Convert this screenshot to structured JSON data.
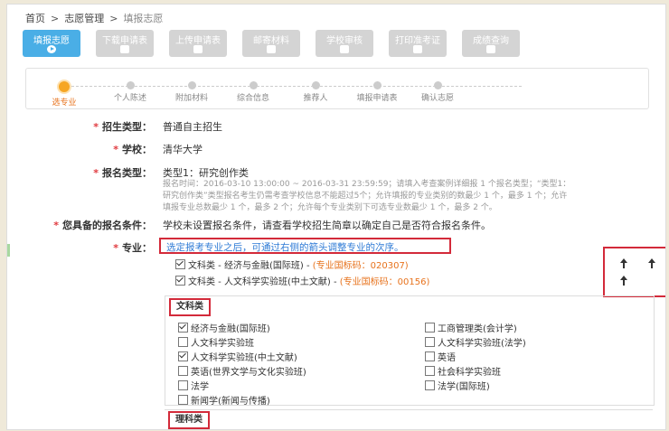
{
  "breadcrumb": [
    "首页",
    "志愿管理",
    "填报志愿"
  ],
  "tabs": [
    {
      "label": "填报志愿",
      "active": true
    },
    {
      "label": "下载申请表",
      "active": false
    },
    {
      "label": "上传申请表",
      "active": false
    },
    {
      "label": "邮寄材料",
      "active": false
    },
    {
      "label": "学校审核",
      "active": false
    },
    {
      "label": "打印准考证",
      "active": false
    },
    {
      "label": "成绩查询",
      "active": false
    }
  ],
  "steps": [
    {
      "label": "选专业",
      "active": true
    },
    {
      "label": "个人陈述",
      "active": false
    },
    {
      "label": "附加材料",
      "active": false
    },
    {
      "label": "综合信息",
      "active": false
    },
    {
      "label": "推荐人",
      "active": false
    },
    {
      "label": "填报申请表",
      "active": false
    },
    {
      "label": "确认志愿",
      "active": false
    }
  ],
  "form": {
    "recruit_type_label": "招生类型：",
    "recruit_type_value": "普通自主招生",
    "school_label": "学校：",
    "school_value": "清华大学",
    "apply_type_label": "报名类型：",
    "apply_type_value": "类型1：研究创作类",
    "note_line1": "报名时间：2016-03-10 13:00:00 ~ 2016-03-31 23:59:59；请填入考查案例详细报 1 个报名类型；“类型1：",
    "note_line2": "研究创作类”类型报名考生仍需考查学校信息不能超过5个；允许填报的专业类别的数最少 1 个，最多 1 个；允许",
    "note_line3": "填报专业总数最少 1 个，最多 2 个；允许每个专业类别下可选专业数最少 1 个，最多 2 个。",
    "condition_label": "您具备的报名条件：",
    "condition_value": "学校未设置报名条件，请查看学校招生简章以确定自己是否符合报名条件。",
    "major_label": "专业：",
    "major_tip": "选定报考专业之后，可通过右侧的箭头调整专业的次序。"
  },
  "selected_majors": [
    {
      "name": "文科类 - 经济与金融(国际班) - ",
      "code": "(专业国标码：020307)",
      "checked": true
    },
    {
      "name": "文科类 - 人文科学实验班(中土文献) - ",
      "code": "(专业国标码：00156)",
      "checked": true
    }
  ],
  "categories": [
    {
      "title": "文科类",
      "options": [
        {
          "label": "经济与金融(国际班)",
          "checked": true
        },
        {
          "label": "工商管理类(会计学)",
          "checked": false
        },
        {
          "label": "人文科学实验班",
          "checked": false
        },
        {
          "label": "人文科学实验班(法学)",
          "checked": false
        },
        {
          "label": "人文科学实验班(中土文献)",
          "checked": true
        },
        {
          "label": "英语",
          "checked": false
        },
        {
          "label": "英语(世界文学与文化实验班)",
          "checked": false
        },
        {
          "label": "社会科学实验班",
          "checked": false
        },
        {
          "label": "法学",
          "checked": false
        },
        {
          "label": "法学(国际班)",
          "checked": false
        },
        {
          "label": "新闻学(新闻与传播)",
          "checked": false
        }
      ]
    },
    {
      "title": "理科类",
      "options": []
    }
  ]
}
